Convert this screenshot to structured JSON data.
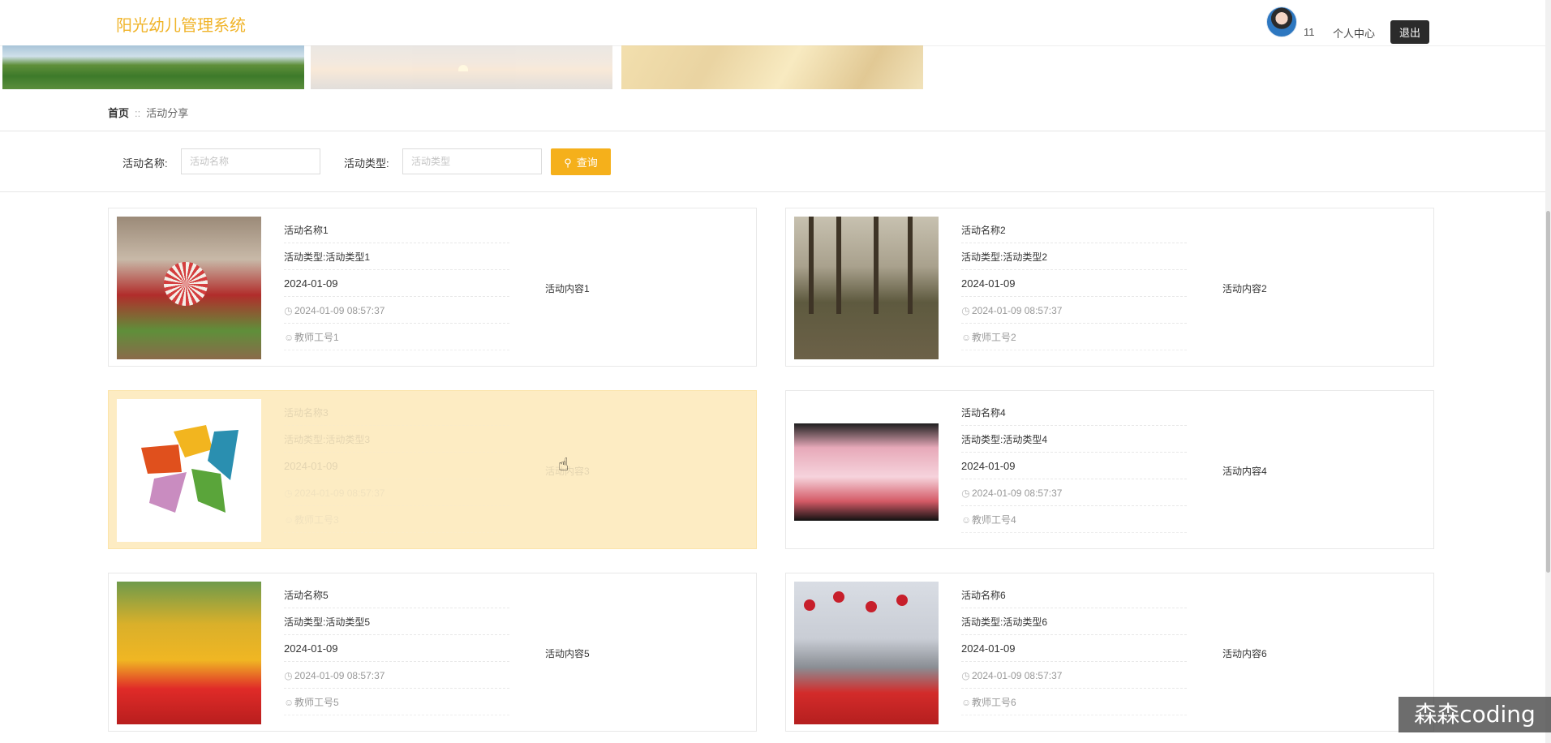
{
  "header": {
    "app_title": "阳光幼儿管理系统",
    "username": "11",
    "profile_link": "个人中心",
    "logout_label": "退出"
  },
  "breadcrumb": {
    "home": "首页",
    "separator": "::",
    "current": "活动分享"
  },
  "search": {
    "name_label": "活动名称:",
    "name_placeholder": "活动名称",
    "type_label": "活动类型:",
    "type_placeholder": "活动类型",
    "button_label": "查询"
  },
  "activities": [
    {
      "name": "活动名称1",
      "type": "活动类型:活动类型1",
      "date": "2024-01-09",
      "created": "2024-01-09 08:57:37",
      "teacher": "教师工号1",
      "content": "活动内容1"
    },
    {
      "name": "活动名称2",
      "type": "活动类型:活动类型2",
      "date": "2024-01-09",
      "created": "2024-01-09 08:57:37",
      "teacher": "教师工号2",
      "content": "活动内容2"
    },
    {
      "name": "活动名称3",
      "type": "活动类型:活动类型3",
      "date": "2024-01-09",
      "created": "2024-01-09 08:57:37",
      "teacher": "教师工号3",
      "content": "活动内容3"
    },
    {
      "name": "活动名称4",
      "type": "活动类型:活动类型4",
      "date": "2024-01-09",
      "created": "2024-01-09 08:57:37",
      "teacher": "教师工号4",
      "content": "活动内容4"
    },
    {
      "name": "活动名称5",
      "type": "活动类型:活动类型5",
      "date": "2024-01-09",
      "created": "2024-01-09 08:57:37",
      "teacher": "教师工号5",
      "content": "活动内容5"
    },
    {
      "name": "活动名称6",
      "type": "活动类型:活动类型6",
      "date": "2024-01-09",
      "created": "2024-01-09 08:57:37",
      "teacher": "教师工号6",
      "content": "活动内容6"
    }
  ],
  "watermark": "森森coding",
  "colors": {
    "accent": "#f5b01b",
    "title": "#f0b42a",
    "hover_card": "#fdecc3",
    "logout_bg": "#2b2b2b"
  },
  "icons": {
    "search": "search-icon",
    "clock": "clock-icon",
    "user": "user-icon"
  }
}
